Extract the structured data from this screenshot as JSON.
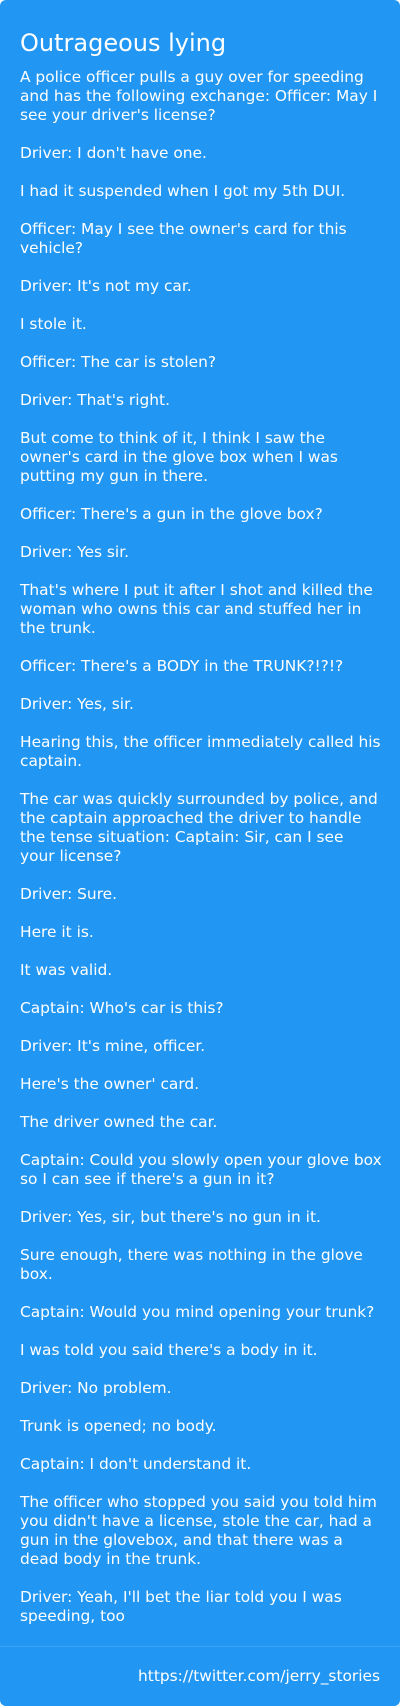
{
  "story": {
    "title": "Outrageous lying",
    "paragraphs": [
      "A police officer pulls a guy over for speeding and has the following exchange: Officer: May I see your driver's license?",
      "Driver: I don't have one.",
      "I had it suspended when I got my 5th DUI.",
      "Officer: May I see the owner's card for this vehicle?",
      "Driver: It's not my car.",
      "I stole it.",
      "Officer: The car is stolen?",
      "Driver: That's right.",
      "But come to think of it, I think I saw the owner's card in the glove box when I was putting my gun in there.",
      "Officer: There's a gun in the glove box?",
      "Driver: Yes sir.",
      "That's where I put it after I shot and killed the woman who owns this car and stuffed her in the trunk.",
      "Officer: There's a BODY in the TRUNK?!?!?",
      "Driver: Yes, sir.",
      "Hearing this, the officer immediately called his captain.",
      "The car was quickly surrounded by police, and the captain approached the driver to handle the tense situation: Captain: Sir, can I see your license?",
      "Driver: Sure.",
      "Here it is.",
      "It was valid.",
      "Captain: Who's car is this?",
      "Driver: It's mine, officer.",
      "Here's the owner' card.",
      "The driver owned the car.",
      "Captain: Could you slowly open your glove box so I can see if there's a gun in it?",
      "Driver: Yes, sir, but there's no gun in it.",
      "Sure enough, there was nothing in the glove box.",
      "Captain: Would you mind opening your trunk?",
      "I was told you said there's a body in it.",
      "Driver: No problem.",
      "Trunk is opened; no body.",
      "Captain: I don't understand it.",
      "The officer who stopped you said you told him you didn't have a license, stole the car, had a gun in the glovebox, and that there was a dead body in the trunk.",
      "Driver: Yeah, I'll bet the liar told you I was speeding, too"
    ]
  },
  "footer": {
    "source_link": "https://twitter.com/jerry_stories"
  },
  "colors": {
    "card_background": "#2196f3",
    "text": "#ffffff",
    "divider": "#3aa3f5"
  }
}
